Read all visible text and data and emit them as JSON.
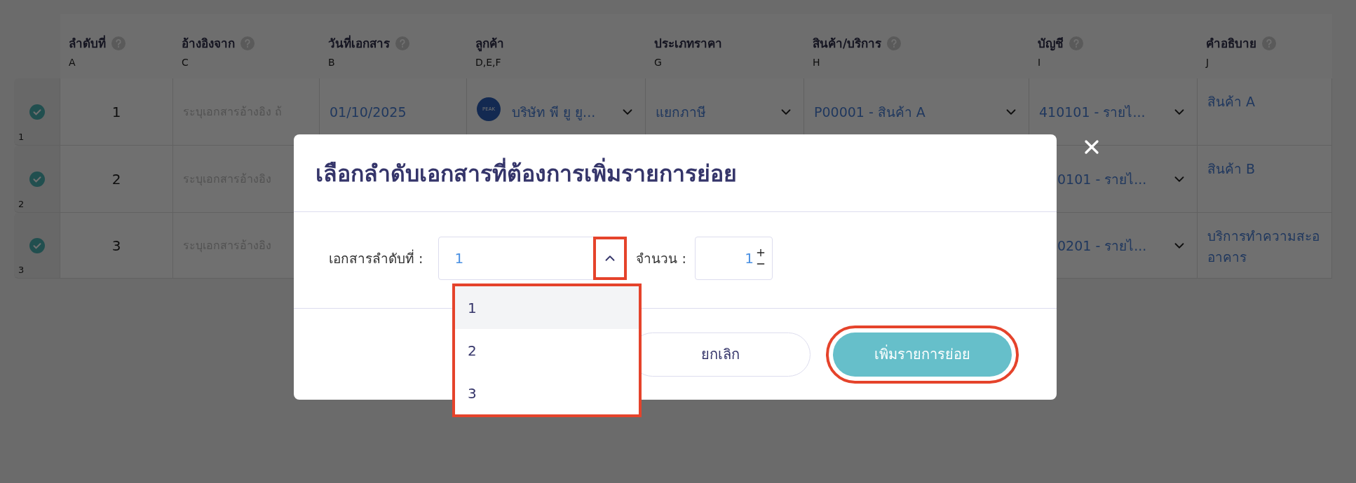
{
  "table": {
    "columns": [
      {
        "label": "ลำดับที่",
        "help": true,
        "letter": "A"
      },
      {
        "label": "อ้างอิงจาก",
        "help": true,
        "letter": "C"
      },
      {
        "label": "วันที่เอกสาร",
        "help": true,
        "letter": "B"
      },
      {
        "label": "ลูกค้า",
        "help": false,
        "letter": "D,E,F"
      },
      {
        "label": "ประเภทราคา",
        "help": false,
        "letter": "G"
      },
      {
        "label": "สินค้า/บริการ",
        "help": true,
        "letter": "H"
      },
      {
        "label": "บัญชี",
        "help": true,
        "letter": "I"
      },
      {
        "label": "คำอธิบาย",
        "help": true,
        "letter": "J"
      }
    ],
    "rows": [
      {
        "index": "1",
        "checked": true,
        "seq": "1",
        "reference_placeholder": "ระบุเอกสารอ้างอิง ถ้",
        "date": "01/10/2025",
        "customer_logo": "PEAK",
        "customer": "บริษัท พี ยู ยู...",
        "price_type": "แยกภาษี",
        "product": "P00001 - สินค้า A",
        "account": "410101 - รายไ...",
        "description": "สินค้า A"
      },
      {
        "index": "2",
        "checked": true,
        "seq": "2",
        "reference_placeholder": "ระบุเอกสารอ้างอิง",
        "account_partial": "0101 - รายไ...",
        "description": "สินค้า B"
      },
      {
        "index": "3",
        "checked": true,
        "seq": "3",
        "reference_placeholder": "ระบุเอกสารอ้างอิง",
        "account_partial": "0201 - รายไ...",
        "description": "บริการทำความสะอ\nอาคาร"
      }
    ]
  },
  "dialog": {
    "title": "เลือกลำดับเอกสารที่ต้องการเพิ่มรายการย่อย",
    "document_label": "เอกสารลำดับที่ :",
    "document_value": "1",
    "expanded": true,
    "arrow_highlighted": true,
    "options": [
      {
        "label": "1",
        "selected": true
      },
      {
        "label": "2",
        "selected": false
      },
      {
        "label": "3",
        "selected": false
      }
    ],
    "options_highlighted": true,
    "quantity_label": "จำนวน :",
    "quantity_value": "1",
    "cancel": "ยกเลิก",
    "confirm": "เพิ่มรายการย่อย",
    "confirm_highlighted": true
  }
}
